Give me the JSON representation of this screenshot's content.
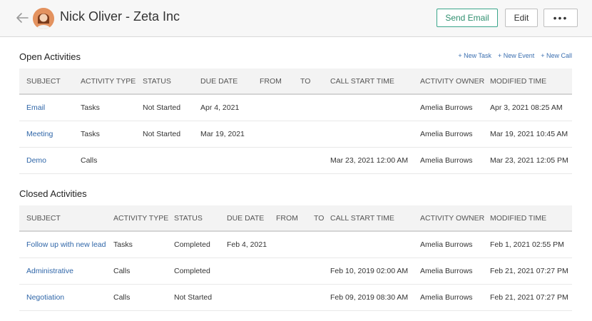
{
  "header": {
    "title": "Nick Oliver - Zeta Inc",
    "send_email_label": "Send Email",
    "edit_label": "Edit",
    "more_label": "•••"
  },
  "open_activities": {
    "title": "Open Activities",
    "new_links": [
      "+ New Task",
      "+ New Event",
      "+ New Call"
    ],
    "columns": [
      "SUBJECT",
      "ACTIVITY TYPE",
      "STATUS",
      "DUE DATE",
      "FROM",
      "TO",
      "CALL START TIME",
      "ACTIVITY OWNER",
      "MODIFIED TIME"
    ],
    "rows": [
      {
        "subject": "Email",
        "type": "Tasks",
        "status": "Not Started",
        "due": "Apr 4, 2021",
        "from": "",
        "to": "",
        "call_start": "",
        "owner": "Amelia Burrows",
        "modified": "Apr 3, 2021 08:25 AM"
      },
      {
        "subject": "Meeting",
        "type": "Tasks",
        "status": "Not Started",
        "due": "Mar 19, 2021",
        "from": "",
        "to": "",
        "call_start": "",
        "owner": "Amelia Burrows",
        "modified": "Mar 19, 2021 10:45 AM"
      },
      {
        "subject": "Demo",
        "type": "Calls",
        "status": "",
        "due": "",
        "from": "",
        "to": "",
        "call_start": "Mar 23, 2021 12:00 AM",
        "owner": "Amelia Burrows",
        "modified": "Mar 23, 2021 12:05 PM"
      }
    ]
  },
  "closed_activities": {
    "title": "Closed Activities",
    "columns": [
      "SUBJECT",
      "ACTIVITY TYPE",
      "STATUS",
      "DUE DATE",
      "FROM",
      "TO",
      "CALL START TIME",
      "ACTIVITY OWNER",
      "MODIFIED TIME"
    ],
    "rows": [
      {
        "subject": "Follow up with new lead",
        "type": "Tasks",
        "status": "Completed",
        "due": "Feb 4, 2021",
        "from": "",
        "to": "",
        "call_start": "",
        "owner": "Amelia Burrows",
        "modified": "Feb 1, 2021 02:55 PM"
      },
      {
        "subject": "Administrative",
        "type": "Calls",
        "status": "Completed",
        "due": "",
        "from": "",
        "to": "",
        "call_start": "Feb 10, 2019 02:00 AM",
        "owner": "Amelia Burrows",
        "modified": "Feb 21, 2021 07:27 PM"
      },
      {
        "subject": "Negotiation",
        "type": "Calls",
        "status": "Not Started",
        "due": "",
        "from": "",
        "to": "",
        "call_start": "Feb 09, 2019 08:30 AM",
        "owner": "Amelia Burrows",
        "modified": "Feb 21, 2021 07:27 PM"
      }
    ]
  },
  "colors": {
    "link": "#2f66a8",
    "send_email_border": "#3aa58a"
  }
}
